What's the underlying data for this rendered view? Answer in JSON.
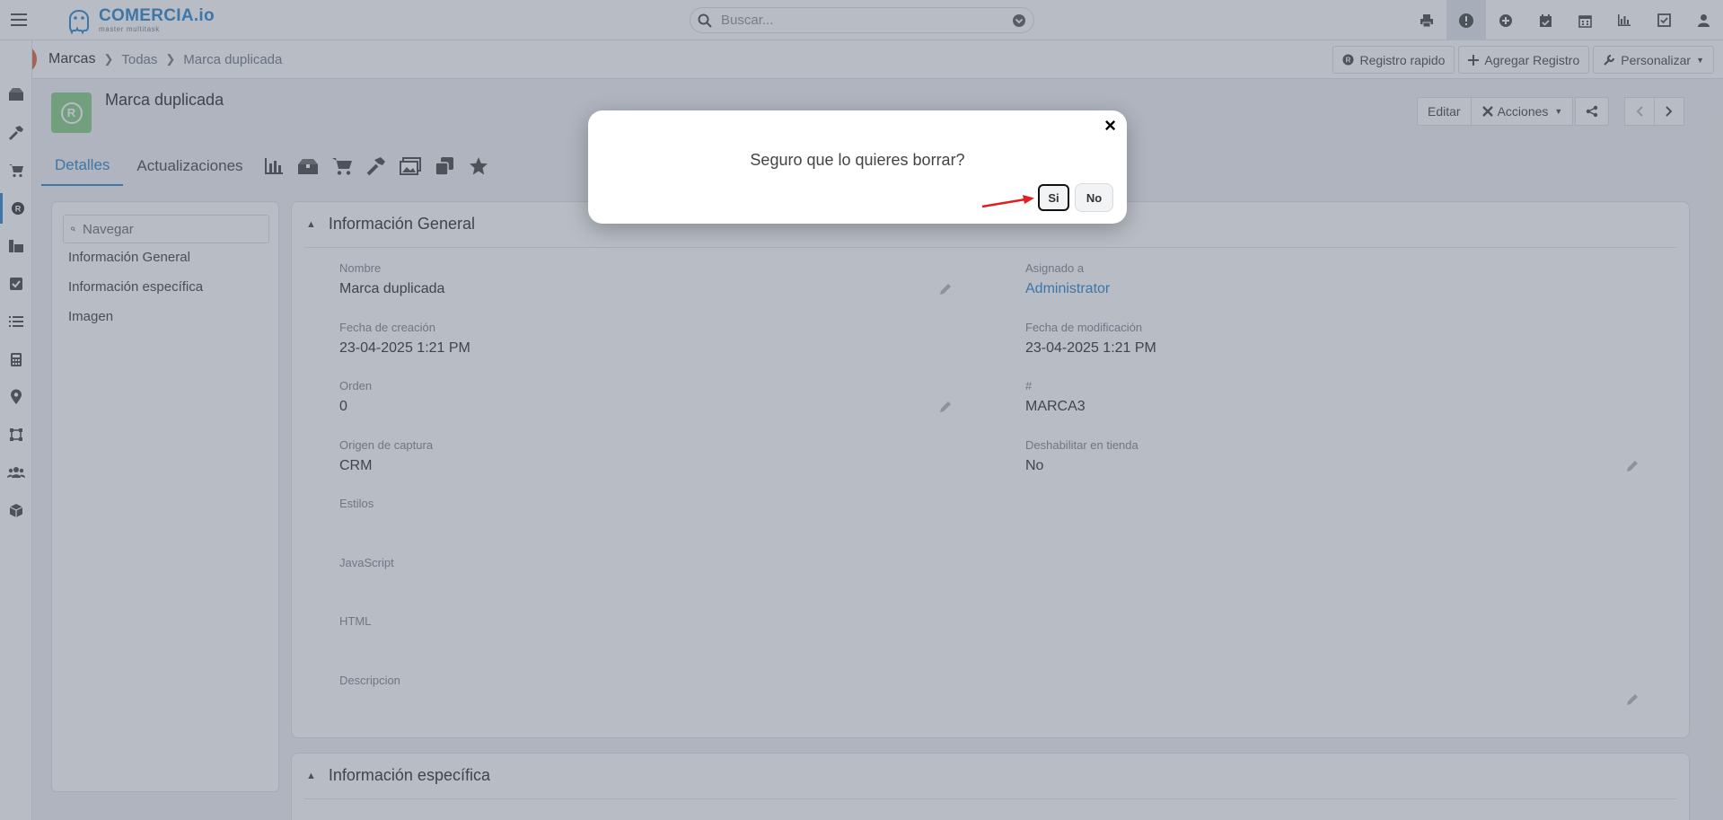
{
  "app": {
    "logo_name": "COMERCIA.io",
    "logo_tagline": "master multitask"
  },
  "search": {
    "placeholder": "Buscar..."
  },
  "top_icons": [
    "printer-icon",
    "alert-icon",
    "plus-circle-icon",
    "calendar-check-icon",
    "calendar-icon",
    "chart-icon",
    "checkbox-icon",
    "user-icon"
  ],
  "left_nav_icons": [
    "boxes-icon",
    "hammer-icon",
    "cart-icon",
    "brand-icon",
    "inventory-icon",
    "task-icon",
    "list-icon",
    "calculator-icon",
    "map-pin-icon",
    "shape-icon",
    "users-icon",
    "package-icon"
  ],
  "breadcrumb": {
    "module": "Marcas",
    "level2": "Todas",
    "level3": "Marca duplicada"
  },
  "crumb_actions": {
    "quick": "Registro rapido",
    "add": "Agregar Registro",
    "customize": "Personalizar"
  },
  "record": {
    "avatar_letter": "R",
    "title": "Marca duplicada",
    "edit": "Editar",
    "actions": "Acciones"
  },
  "tabs": {
    "details": "Detalles",
    "updates": "Actualizaciones",
    "icons": [
      "chart-icon",
      "boxes-icon",
      "cart-icon",
      "hammer-icon",
      "images-icon",
      "copy-icon",
      "star-icon"
    ]
  },
  "left_panel": {
    "search_placeholder": "Navegar",
    "items": [
      "Información General",
      "Información específica",
      "Imagen"
    ]
  },
  "section_general": {
    "title": "Información General",
    "fields": {
      "nombre": {
        "label": "Nombre",
        "value": "Marca duplicada"
      },
      "asignado": {
        "label": "Asignado a",
        "value": "Administrator"
      },
      "fecha_creacion": {
        "label": "Fecha de creación",
        "value": "23-04-2025 1:21 PM"
      },
      "fecha_mod": {
        "label": "Fecha de modificación",
        "value": "23-04-2025 1:21 PM"
      },
      "orden": {
        "label": "Orden",
        "value": "0"
      },
      "numero": {
        "label": "#",
        "value": "MARCA3"
      },
      "origen": {
        "label": "Origen de captura",
        "value": "CRM"
      },
      "deshabilitar": {
        "label": "Deshabilitar en tienda",
        "value": "No"
      },
      "estilos": {
        "label": "Estilos",
        "value": ""
      },
      "javascript": {
        "label": "JavaScript",
        "value": ""
      },
      "html": {
        "label": "HTML",
        "value": ""
      },
      "descripcion": {
        "label": "Descripcion",
        "value": ""
      }
    }
  },
  "section_specific": {
    "title": "Información específica"
  },
  "modal": {
    "message": "Seguro que lo quieres borrar?",
    "yes": "Si",
    "no": "No",
    "close": "×"
  },
  "colors": {
    "accent": "#3a8fd0",
    "module_badge": "#d9734e",
    "avatar": "#8fd18d",
    "annotation_arrow": "#e02020"
  }
}
